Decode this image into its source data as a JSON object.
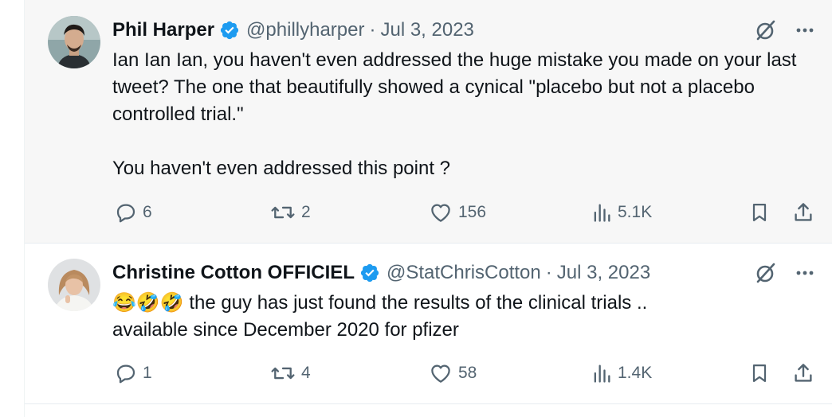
{
  "tweets": [
    {
      "author": "Phil Harper",
      "handle": "@phillyharper",
      "separator": "·",
      "date": "Jul 3, 2023",
      "body": "Ian Ian Ian, you haven't even addressed the huge mistake you made on your last tweet? The one that beautifully showed a cynical \"placebo but not a placebo controlled trial.\"\n\nYou haven't even addressed this point ?",
      "stats": {
        "replies": "6",
        "reposts": "2",
        "likes": "156",
        "views": "5.1K"
      }
    },
    {
      "author": "Christine Cotton OFFICIEL",
      "handle": "@StatChrisCotton",
      "separator": "·",
      "date": "Jul 3, 2023",
      "body": "😂🤣🤣 the guy has just found the results of the clinical trials ..\navailable since December 2020 for pfizer",
      "stats": {
        "replies": "1",
        "reposts": "4",
        "likes": "58",
        "views": "1.4K"
      }
    }
  ],
  "icons": {
    "verified": "verified-badge-icon",
    "grok": "grok-icon",
    "more": "more-icon",
    "reply": "reply-icon",
    "repost": "repost-icon",
    "like": "like-icon",
    "views": "views-icon",
    "bookmark": "bookmark-icon",
    "share": "share-icon"
  },
  "colors": {
    "verified": "#1d9bf0",
    "secondary_text": "#536471",
    "primary_text": "#0f1419",
    "highlight_bg": "#f7f7f7"
  }
}
